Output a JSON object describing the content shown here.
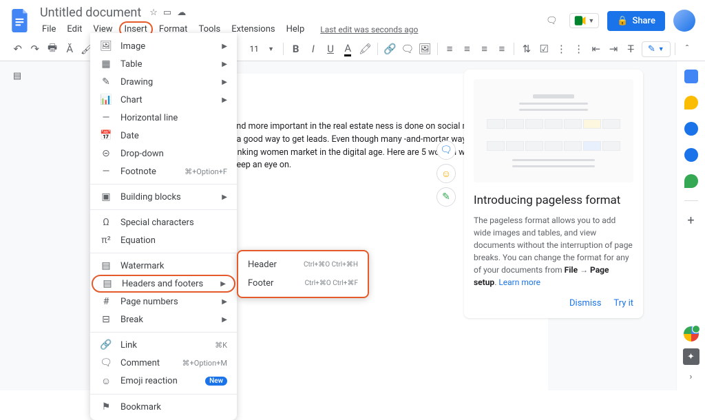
{
  "header": {
    "doc_title": "Untitled document",
    "last_edit": "Last edit was seconds ago",
    "share_label": "Share"
  },
  "menubar": [
    "File",
    "Edit",
    "View",
    "Insert",
    "Format",
    "Tools",
    "Extensions",
    "Help"
  ],
  "menubar_highlighted_index": 3,
  "toolbar": {
    "font_size": "11"
  },
  "insert_menu": {
    "groups": [
      [
        {
          "icon": "image-icon",
          "glyph": "🖼",
          "label": "Image",
          "arrow": true
        },
        {
          "icon": "table-icon",
          "glyph": "▦",
          "label": "Table",
          "arrow": true
        },
        {
          "icon": "drawing-icon",
          "glyph": "✎",
          "label": "Drawing",
          "arrow": true
        },
        {
          "icon": "chart-icon",
          "glyph": "📊",
          "label": "Chart",
          "arrow": true
        },
        {
          "icon": "hr-icon",
          "glyph": "—",
          "label": "Horizontal line"
        },
        {
          "icon": "date-icon",
          "glyph": "📅",
          "label": "Date"
        },
        {
          "icon": "dropdown-icon",
          "glyph": "⊝",
          "label": "Drop-down"
        },
        {
          "icon": "footnote-icon",
          "glyph": "—",
          "label": "Footnote",
          "shortcut": "⌘+Option+F"
        }
      ],
      [
        {
          "icon": "blocks-icon",
          "glyph": "▣",
          "label": "Building blocks",
          "arrow": true
        }
      ],
      [
        {
          "icon": "special-chars-icon",
          "glyph": "Ω",
          "label": "Special characters"
        },
        {
          "icon": "equation-icon",
          "glyph": "π²",
          "label": "Equation"
        }
      ],
      [
        {
          "icon": "watermark-icon",
          "glyph": "▤",
          "label": "Watermark"
        },
        {
          "icon": "headers-footers-icon",
          "glyph": "▤",
          "label": "Headers and footers",
          "arrow": true,
          "highlighted": true
        },
        {
          "icon": "page-numbers-icon",
          "glyph": "#",
          "label": "Page numbers",
          "arrow": true
        },
        {
          "icon": "break-icon",
          "glyph": "⊟",
          "label": "Break",
          "arrow": true
        }
      ],
      [
        {
          "icon": "link-icon",
          "glyph": "🔗",
          "label": "Link",
          "shortcut": "⌘K"
        },
        {
          "icon": "comment-icon",
          "glyph": "🗨",
          "label": "Comment",
          "shortcut": "⌘+Option+M"
        },
        {
          "icon": "emoji-icon",
          "glyph": "☺",
          "label": "Emoji reaction",
          "badge": "New"
        }
      ],
      [
        {
          "icon": "bookmark-icon",
          "glyph": "⚑",
          "label": "Bookmark"
        }
      ]
    ]
  },
  "submenu": {
    "items": [
      {
        "label": "Header",
        "shortcut": "Ctrl+⌘O Ctrl+⌘H"
      },
      {
        "label": "Footer",
        "shortcut": "Ctrl+⌘O Ctrl+⌘F"
      }
    ]
  },
  "document_body": "me more and more important in the real estate ness is done on social media platforms, a good way to get leads. Even though many -and-mortar ways, some forward-thinking women market in the digital age. Here are 5 women who hould definitely keep an eye on.",
  "info_card": {
    "title": "Introducing pageless format",
    "body_pre": "The pageless format allows you to add wide images and tables, and view documents without the interruption of page breaks. You can change the format for any of your documents from ",
    "bold1": "File",
    "arrow": " → ",
    "bold2": "Page setup",
    "period": ". ",
    "learn_more": "Learn more",
    "dismiss": "Dismiss",
    "try_it": "Try it"
  }
}
